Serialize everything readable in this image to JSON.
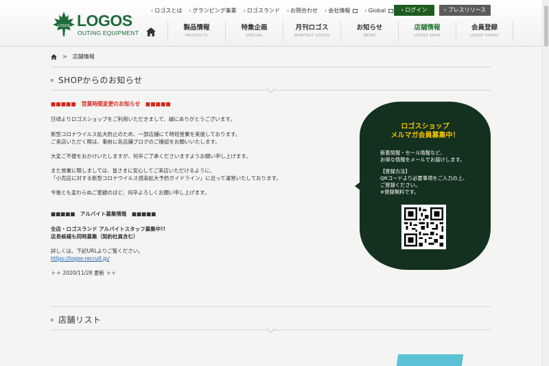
{
  "header": {
    "logo_text": "LOGOS",
    "logo_sub": "OUTING EQUIPMENT",
    "logo_badge": "LOGOS",
    "utility_links": [
      {
        "label": "ロゴスとは",
        "external": false
      },
      {
        "label": "グランピング事業",
        "external": false
      },
      {
        "label": "ロゴスランド",
        "external": false
      },
      {
        "label": "お問合わせ",
        "external": false
      },
      {
        "label": "会社情報",
        "external": true
      },
      {
        "label": "Global",
        "external": true
      }
    ],
    "login_label": "ログイン",
    "press_label": "プレスリリース",
    "nav": [
      {
        "jp": "製品情報",
        "en": "PRODUCTS",
        "active": false
      },
      {
        "jp": "特集企画",
        "en": "SPECIAL",
        "active": false
      },
      {
        "jp": "月刊ロゴス",
        "en": "MONTHLY LOGOS",
        "active": false
      },
      {
        "jp": "お知らせ",
        "en": "NEWS",
        "active": false
      },
      {
        "jp": "店舗情報",
        "en": "LOGOS SHOP",
        "active": true
      },
      {
        "jp": "会員登録",
        "en": "LOGOS FAMILY",
        "active": false
      }
    ]
  },
  "breadcrumb": {
    "sep": ">",
    "current": "店舗情報"
  },
  "sections": {
    "notice_title": "SHOPからのお知らせ",
    "shoplist_title": "店舗リスト"
  },
  "notice": {
    "heading1": "■■■■■　営業時間変更のお知らせ　■■■■■",
    "p1": "日頃よりロゴスショップをご利用いただきまして、誠にありがとうございます。",
    "p2a": "新型コロナウイルス拡大防止のため、一部店舗にて時短営業を実施しております。",
    "p2b": "ご来店いただく際は、事前に各店舗ブログのご確認をお願いいたします。",
    "p3": "大変ご不便をおかけいたしますが、何卒ご了承くださいますようお願い申し上げます。",
    "p4a": "また営業に際しましては、皆さまに安心してご来店いただけるように、",
    "p4b": "「小売店に対する新型コロナウイルス感染拡大予防ガイドライン」に沿って運営いたしております。",
    "p5": "今後とも変わらぬご愛顧のほど、何卒よろしくお願い申し上げます。",
    "heading2": "■■■■■　アルバイト募集情報　■■■■■",
    "job1": "全店・ロゴスランド アルバイトスタッフ募集中!!",
    "job2": "店長候補も同時募集（契約社員含む）",
    "detail": "詳しくは、下記URLよりご覧ください。",
    "url": "https://logos-recruit.jp/",
    "updated": "＋＋ 2020/11/28 更新 ＋＋"
  },
  "bubble": {
    "title1": "ロゴスショップ",
    "title2": "メルマガ会員募集中！",
    "t1": "新着情報・セール情報など、",
    "t2": "お得な情報をメールでお届けします。",
    "t3": "【登録方法】",
    "t4": "QRコードより必要事項をご入力の上、",
    "t5": "ご登録ください。",
    "t6": "※登録無料です。"
  },
  "colors": {
    "brand_green": "#1d6b3a",
    "login_bg": "#1d5c1f",
    "press_bg": "#5b5b5b",
    "alert_red": "#d4281b",
    "bubble_bg": "#14311f",
    "bubble_title": "#f2c200",
    "link": "#1e5faa",
    "shop_tab": "#5bc1d5"
  },
  "icons": {
    "home": "home-icon",
    "logo": "maple-leaf-icon",
    "external": "external-link-icon",
    "chevron": "chevron-down-icon"
  }
}
